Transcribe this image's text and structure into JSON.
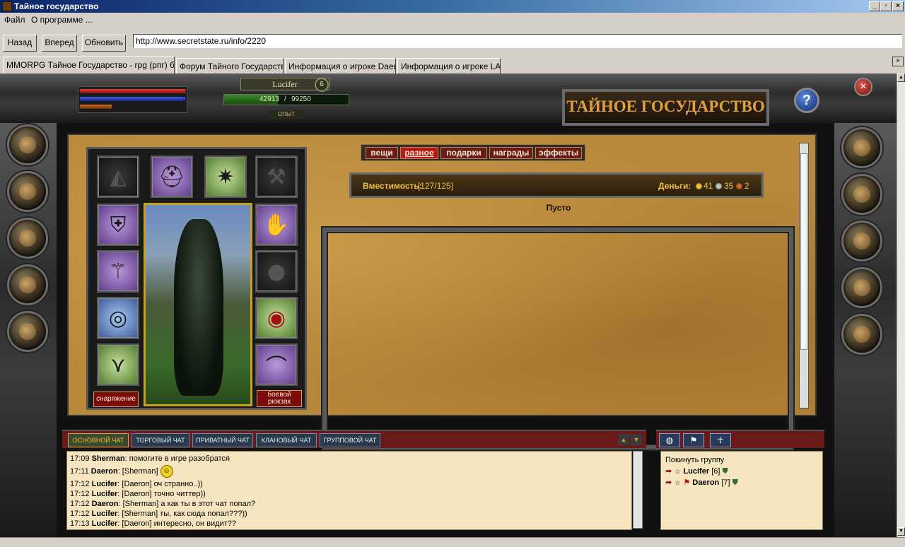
{
  "window": {
    "title": "Тайное государство"
  },
  "menu": {
    "file": "Файл",
    "about": "О программе ..."
  },
  "nav": {
    "back": "Назад",
    "forward": "Вперед",
    "refresh": "Обновить",
    "url": "http://www.secretstate.ru/info/2220"
  },
  "tabs": [
    {
      "label": "MMORPG Тайное Государство - rpg (рпг) бр ..."
    },
    {
      "label": "Форум Тайного Государства"
    },
    {
      "label": "Информация о игроке Daeron"
    },
    {
      "label": "Информация о игроке LADY"
    }
  ],
  "player": {
    "name": "Lucifer",
    "level": "6",
    "exp_current": "42913",
    "exp_sep": "/",
    "exp_max": "99250",
    "exp_label": "ОПЫТ",
    "exp_fraction": 0.432
  },
  "bars": {
    "health_fraction": 1.0,
    "mana_fraction": 1.0,
    "energy_fraction": 0.3
  },
  "logo": {
    "text": "Тайное государство"
  },
  "equipment": {
    "gear_button": "снаряжение",
    "backpack_button_l1": "боевой",
    "backpack_button_l2": "рюкзак"
  },
  "inventory": {
    "tabs": [
      "вещи",
      "разное",
      "подарки",
      "награды",
      "эффекты"
    ],
    "active_tab": "разное",
    "capacity_label": "Вместимость:",
    "capacity_value": "[127/125]",
    "money_label": "Деньги:",
    "gold": "41",
    "silver": "35",
    "copper": "2",
    "empty_text": "Пусто"
  },
  "chat": {
    "tabs": [
      "ОСНОВНОЙ ЧАТ",
      "ТОРГОВЫЙ ЧАТ",
      "ПРИВАТНЫЙ ЧАТ",
      "КЛАНОВЫЙ ЧАТ",
      "ГРУППОВОЙ ЧАТ"
    ],
    "messages": [
      {
        "time": "17:09",
        "user": "Sherman",
        "text": ": помогите в игре разобратся"
      },
      {
        "time": "17:11",
        "user": "Daeron",
        "text": ": [Sherman]"
      },
      {
        "time": "17:12",
        "user": "Lucifer",
        "text": ": [Daeron] оч странно..))"
      },
      {
        "time": "17:12",
        "user": "Lucifer",
        "text": ": [Daeron] точно читтер))"
      },
      {
        "time": "17:12",
        "user": "Daeron",
        "text": ": [Sherman] а как ты в этот чат попал?"
      },
      {
        "time": "17:12",
        "user": "Lucifer",
        "text": ": [Sherman] ты, как сюда попал???))"
      },
      {
        "time": "17:13",
        "user": "Lucifer",
        "text": ": [Daeron] интересно, он видит??"
      }
    ]
  },
  "group": {
    "leave": "Покинуть группу",
    "members": [
      {
        "name": "Lucifer",
        "level": "[6]"
      },
      {
        "name": "Daeron",
        "level": "[7]"
      }
    ]
  },
  "colors": {
    "accent_red": "#6b1a1a",
    "parchment": "#b8893c",
    "gold_text": "#f0c040"
  }
}
